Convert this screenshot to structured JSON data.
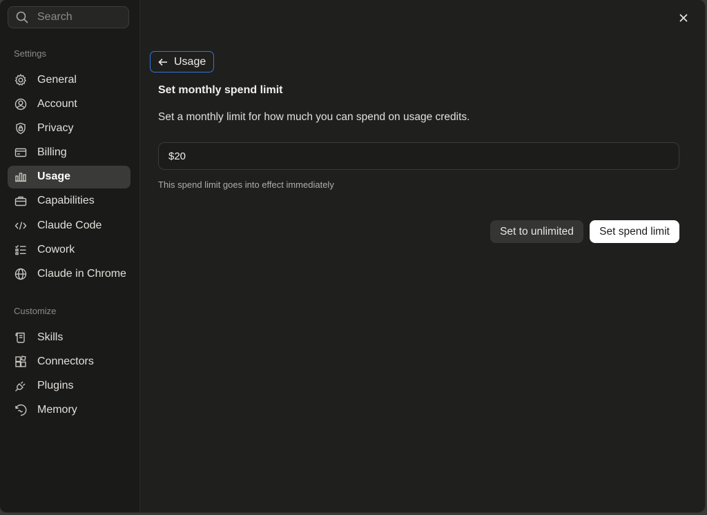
{
  "search": {
    "placeholder": "Search",
    "icon": "search-icon"
  },
  "sidebar": {
    "settings_label": "Settings",
    "settings_items": [
      {
        "label": "General",
        "icon": "gear-icon"
      },
      {
        "label": "Account",
        "icon": "user-circle-icon"
      },
      {
        "label": "Privacy",
        "icon": "shield-lock-icon"
      },
      {
        "label": "Billing",
        "icon": "credit-card-icon"
      },
      {
        "label": "Usage",
        "icon": "bar-chart-icon",
        "active": true
      },
      {
        "label": "Capabilities",
        "icon": "toolbox-icon"
      },
      {
        "label": "Claude Code",
        "icon": "code-icon"
      },
      {
        "label": "Cowork",
        "icon": "checklist-icon"
      },
      {
        "label": "Claude in Chrome",
        "icon": "globe-icon"
      }
    ],
    "customize_label": "Customize",
    "customize_items": [
      {
        "label": "Skills",
        "icon": "scroll-icon"
      },
      {
        "label": "Connectors",
        "icon": "blocks-icon"
      },
      {
        "label": "Plugins",
        "icon": "plug-icon"
      },
      {
        "label": "Memory",
        "icon": "memory-icon"
      }
    ]
  },
  "main": {
    "back_label": "Usage",
    "title": "Set monthly spend limit",
    "description": "Set a monthly limit for how much you can spend on usage credits.",
    "limit_value": "$20",
    "hint": "This spend limit goes into effect immediately",
    "unlimited_label": "Set to unlimited",
    "set_limit_label": "Set spend limit"
  },
  "colors": {
    "focus_ring": "#2f78d8",
    "background": "#1f1f1e",
    "sidebar_active": "#3a3a38",
    "primary_button": "#ffffff"
  }
}
